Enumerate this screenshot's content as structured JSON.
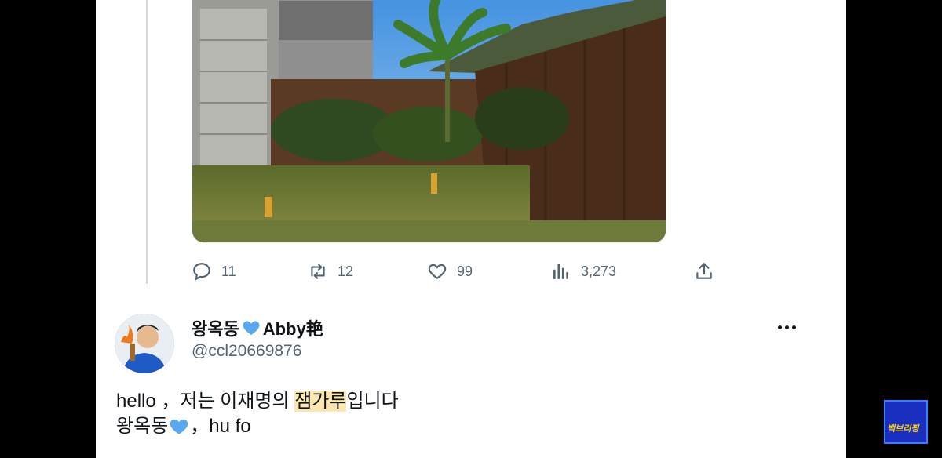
{
  "tweet": {
    "stats": {
      "replies": "11",
      "retweets": "12",
      "likes": "99",
      "views": "3,273"
    }
  },
  "reply": {
    "display_name": "왕옥동",
    "display_name_suffix": "Abby艳",
    "handle": "@ccl20669876",
    "text_line1_pre": "hello ，저는 이재명의 ",
    "text_line1_highlight": "잼가루",
    "text_line1_post": "입니다",
    "text_line2_pre": "왕옥동",
    "text_line2_post": "，hu fo"
  },
  "overlay": {
    "logo_text": "백브리핑"
  },
  "colors": {
    "highlight": "#fde7b0",
    "heart_blue": "#5aa9ee",
    "icon_gray": "#536471"
  }
}
